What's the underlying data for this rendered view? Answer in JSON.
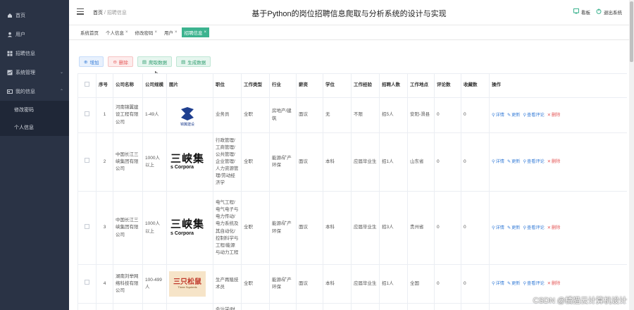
{
  "sidebar": {
    "items": [
      {
        "label": "首页",
        "icon": "home-icon"
      },
      {
        "label": "用户",
        "icon": "user-icon"
      },
      {
        "label": "招聘信息",
        "icon": "grid-icon"
      },
      {
        "label": "系统管理",
        "icon": "chart-icon"
      },
      {
        "label": "我的信息",
        "icon": "card-icon"
      }
    ],
    "submenu": [
      "修改密码",
      "个人信息"
    ]
  },
  "header": {
    "breadcrumb_home": "首页",
    "breadcrumb_sep": "/",
    "breadcrumb_current": "招聘信息",
    "title": "基于Python的岗位招聘信息爬取与分析系统的设计与实现",
    "dashboard": "看板",
    "logout": "退出系统"
  },
  "tabs": [
    {
      "label": "系统首页",
      "closable": false
    },
    {
      "label": "个人信息",
      "closable": true
    },
    {
      "label": "修改密码",
      "closable": true
    },
    {
      "label": "用户",
      "closable": true
    },
    {
      "label": "招聘信息",
      "closable": true,
      "active": true
    }
  ],
  "toolbar": {
    "add": "增加",
    "delete": "删除",
    "crawl": "爬取数据",
    "generate": "生成数据"
  },
  "table": {
    "columns": [
      "序号",
      "公司名称",
      "公司规模",
      "图片",
      "职位",
      "工作类型",
      "行业",
      "薪资",
      "学位",
      "工作经验",
      "招聘人数",
      "工作地点",
      "评论数",
      "收藏数",
      "操作"
    ],
    "rows": [
      {
        "no": "1",
        "company": "河南锦翼建设工程有限公司",
        "size": "1-49人",
        "logo_text": "锦翼建设",
        "position": "业务员",
        "type": "全职",
        "industry": "房地产/建筑",
        "salary": "面议",
        "degree": "无",
        "experience": "不限",
        "headcount": "招5人",
        "location": "安阳-滑县",
        "comments": "0",
        "favorites": "0"
      },
      {
        "no": "2",
        "company": "中国长江三峡集团有限公司",
        "size": "1000人以上",
        "logo_text": "三峡集",
        "logo_sub": "s Corpora",
        "position": "行政管理/工商管理/公共管理/企业管理/人力资源管理/劳动经济学",
        "type": "全职",
        "industry": "能源/矿产环保",
        "salary": "面议",
        "degree": "本科",
        "experience": "应届毕业生",
        "headcount": "招1人",
        "location": "山东省",
        "comments": "0",
        "favorites": "0"
      },
      {
        "no": "3",
        "company": "中国长江三峡集团有限公司",
        "size": "1000人以上",
        "logo_text": "三峡集",
        "logo_sub": "s Corpora",
        "position": "电气工程/电气电子与电力传动/电力系统及其自动化/控制科学与工程/能源与动力工程",
        "type": "全职",
        "industry": "能源/矿产环保",
        "salary": "面议",
        "degree": "本科",
        "experience": "应届毕业生",
        "headcount": "招3人",
        "location": "贵州省",
        "comments": "0",
        "favorites": "0"
      },
      {
        "no": "4",
        "company": "湖南刘举网络科技有限公司",
        "size": "100-499人",
        "logo_text": "三只松鼠",
        "logo_sub": "Three Squirrels",
        "position": "生产再殖技术员",
        "type": "全职",
        "industry": "能源/矿产环保",
        "salary": "面议",
        "degree": "本科",
        "experience": "应届毕业生",
        "headcount": "招1人",
        "location": "全国",
        "comments": "0",
        "favorites": "0"
      },
      {
        "no": "",
        "company": "",
        "size": "",
        "logo_text": "",
        "position": "会计学/财",
        "type": "",
        "industry": "",
        "salary": "",
        "degree": "",
        "experience": "",
        "headcount": "",
        "location": "",
        "comments": "",
        "favorites": ""
      }
    ],
    "ops": {
      "view": "详情",
      "edit": "更新",
      "comment": "查看评论",
      "remove": "删除"
    }
  },
  "watermark": "CSDN @橘猫云计算机设计",
  "colors": {
    "sidebar_bg": "#2a3345",
    "active_tab": "#3cb38f",
    "link": "#3a7fd8",
    "danger": "#e45656"
  }
}
